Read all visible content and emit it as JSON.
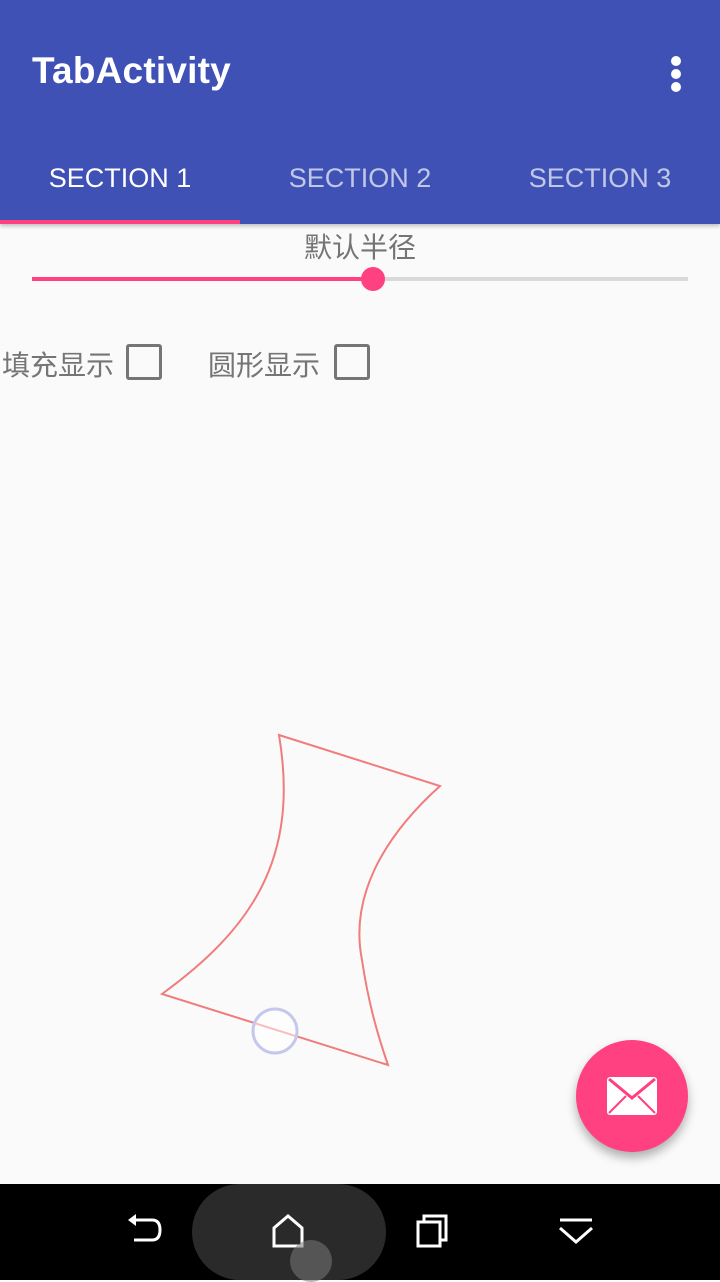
{
  "app_bar": {
    "title": "TabActivity",
    "overflow_icon": "more-vert-icon",
    "background_color": "#3f51b5"
  },
  "tabs": [
    {
      "label": "SECTION 1",
      "selected": true
    },
    {
      "label": "SECTION 2",
      "selected": false
    },
    {
      "label": "SECTION 3",
      "selected": false
    }
  ],
  "accent_color": "#ff4081",
  "radius_slider": {
    "label": "默认半径",
    "value_fraction": 0.52
  },
  "options": {
    "fill": {
      "label": "填充显示",
      "checked": false
    },
    "circle": {
      "label": "圆形显示",
      "checked": false
    }
  },
  "fab": {
    "icon": "mail-icon"
  },
  "nav_bar": {
    "icons": [
      "back-icon",
      "home-icon",
      "recents-icon",
      "hide-nav-icon"
    ]
  }
}
